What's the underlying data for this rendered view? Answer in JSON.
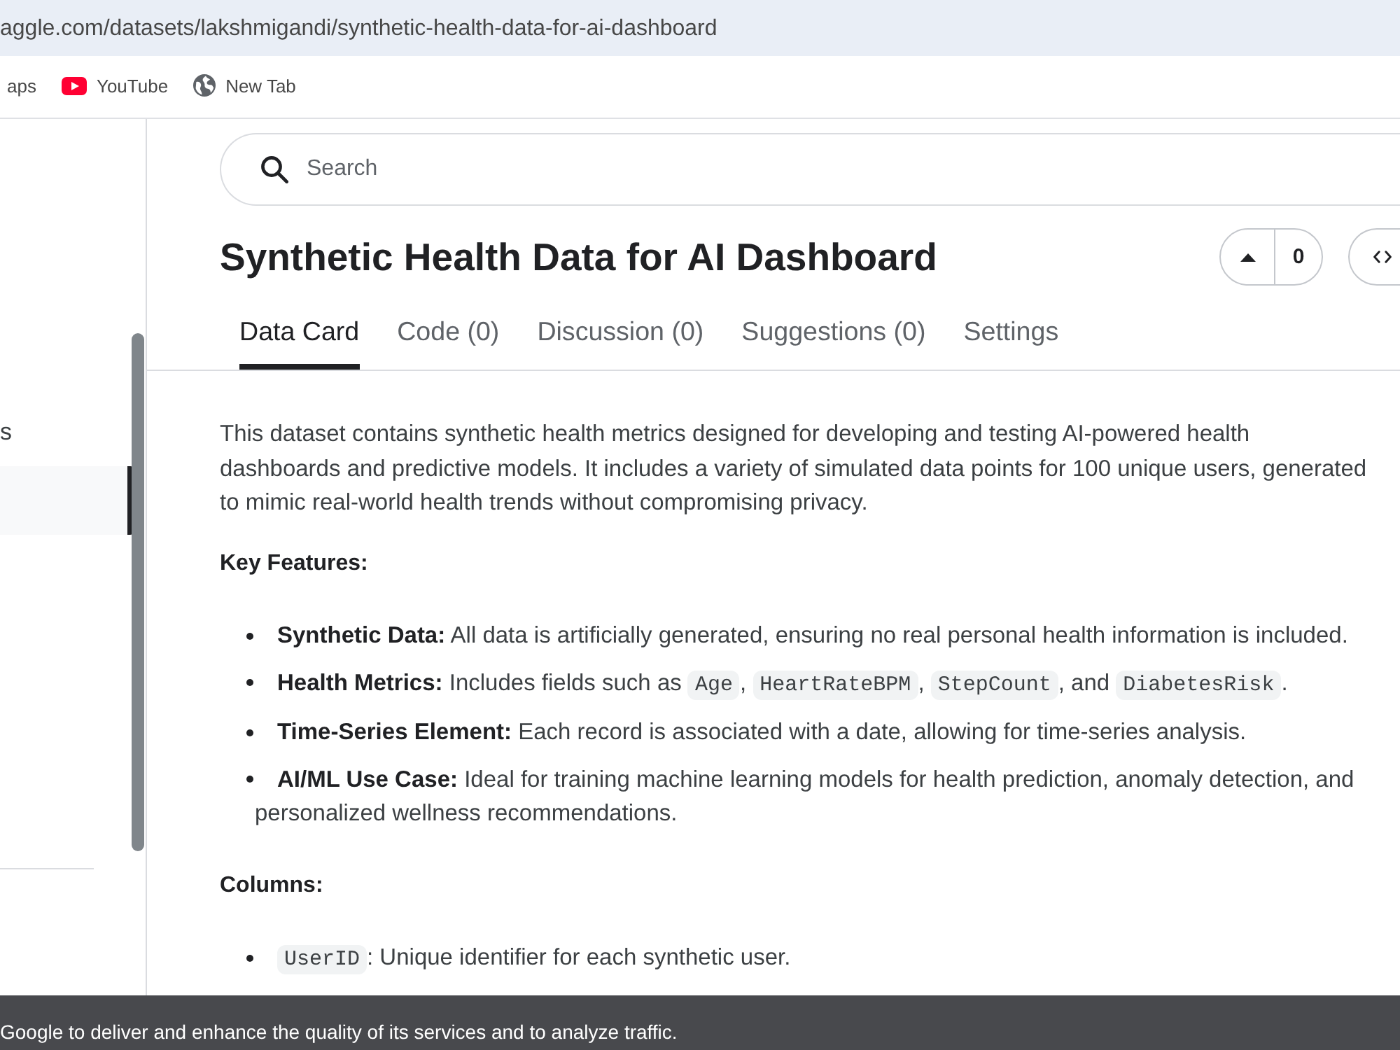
{
  "browser": {
    "url": "aggle.com/datasets/lakshmigandi/synthetic-health-data-for-ai-dashboard",
    "bookmarks": [
      {
        "kind": "plain",
        "label": "aps"
      },
      {
        "kind": "video",
        "label": "YouTube"
      },
      {
        "kind": "page",
        "label": "New Tab"
      }
    ]
  },
  "sidebar": {
    "items": [
      {
        "label": "s",
        "selected": false
      },
      {
        "selected": true
      }
    ]
  },
  "search": {
    "placeholder": "Search"
  },
  "dataset": {
    "title": "Synthetic Health Data for AI Dashboard",
    "upvotes": "0"
  },
  "tabs": [
    {
      "label": "Data Card",
      "selected": true
    },
    {
      "label": "Code (0)",
      "selected": false
    },
    {
      "label": "Discussion (0)",
      "selected": false
    },
    {
      "label": "Suggestions (0)",
      "selected": false
    },
    {
      "label": "Settings",
      "selected": false
    }
  ],
  "description": "This dataset contains synthetic health metrics designed for developing and testing AI-powered health dashboards and predictive models. It includes a variety of simulated data points for 100 unique users, generated to mimic real-world health trends without compromising privacy.",
  "sections": [
    {
      "heading": "Key Features:",
      "items": [
        {
          "runs": [
            {
              "kind": "text",
              "text": "**Synthetic Data:** All data is artificially generated, ensuring no real personal health information is included."
            }
          ]
        },
        {
          "runs": [
            {
              "kind": "text",
              "text": "**Health Metrics:** Includes fields such as "
            },
            {
              "kind": "code",
              "text": "Age"
            },
            {
              "kind": "text",
              "text": ", "
            },
            {
              "kind": "code",
              "text": "HeartRateBPM"
            },
            {
              "kind": "text",
              "text": ", "
            },
            {
              "kind": "code",
              "text": "StepCount"
            },
            {
              "kind": "text",
              "text": ", and "
            },
            {
              "kind": "code",
              "text": "DiabetesRisk"
            },
            {
              "kind": "text",
              "text": "."
            }
          ]
        },
        {
          "runs": [
            {
              "kind": "text",
              "text": "**Time-Series Element:** Each record is associated with a date, allowing for time-series analysis."
            }
          ]
        },
        {
          "runs": [
            {
              "kind": "text",
              "text": "**AI/ML Use Case:** Ideal for training machine learning models for health prediction, anomaly detection, and personalized wellness recommendations."
            }
          ]
        }
      ]
    },
    {
      "heading": "Columns:",
      "items": [
        {
          "runs": [
            {
              "kind": "code",
              "text": "UserID"
            },
            {
              "kind": "text",
              "text": ": Unique identifier for each synthetic user."
            }
          ]
        }
      ]
    }
  ],
  "cookie_banner": {
    "text": "Google to deliver and enhance the quality of its services and to analyze traffic."
  }
}
